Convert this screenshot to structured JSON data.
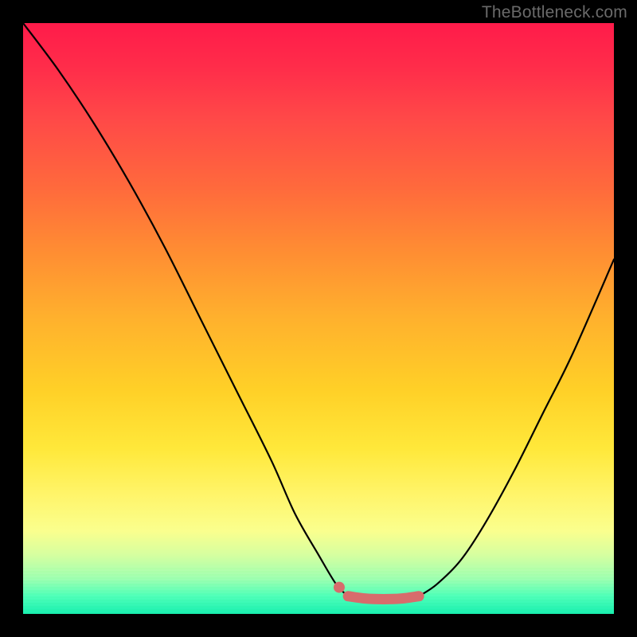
{
  "watermark": "TheBottleneck.com",
  "colors": {
    "frame_border": "#000000",
    "curve_black": "#000000",
    "curve_pink": "#d76c6c",
    "dot_pink": "#d76c6c"
  },
  "chart_data": {
    "type": "line",
    "title": "",
    "xlabel": "",
    "ylabel": "",
    "xlim": [
      0,
      100
    ],
    "ylim": [
      0,
      100
    ],
    "series": [
      {
        "name": "left-curve",
        "x": [
          0,
          6,
          12,
          18,
          24,
          30,
          36,
          42,
          46,
          50,
          53,
          55
        ],
        "values": [
          100,
          92,
          83,
          73,
          62,
          50,
          38,
          26,
          17,
          10,
          5,
          3
        ]
      },
      {
        "name": "right-curve",
        "x": [
          67,
          70,
          74,
          78,
          83,
          88,
          93,
          100
        ],
        "values": [
          3,
          5,
          9,
          15,
          24,
          34,
          44,
          60
        ]
      },
      {
        "name": "trough-flat",
        "x": [
          55,
          58,
          61,
          64,
          67
        ],
        "values": [
          3,
          2.6,
          2.5,
          2.6,
          3
        ]
      }
    ],
    "markers": [
      {
        "name": "trough-start-dot",
        "x": 53.5,
        "y": 4.5
      }
    ]
  }
}
